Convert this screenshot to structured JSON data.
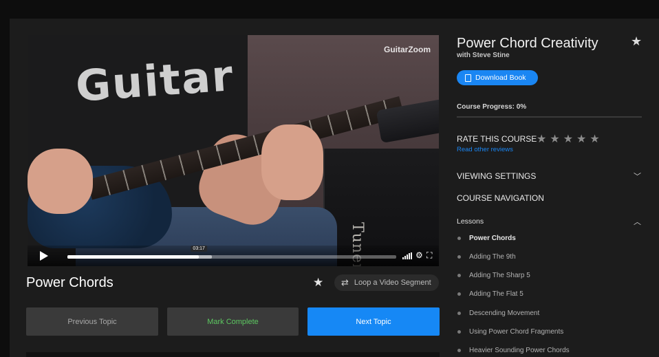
{
  "video": {
    "watermark": "GuitarZoom",
    "amp_brand": "Tuner",
    "shirt_text": "Guitar",
    "time_tooltip": "03:17",
    "progress_fraction": 0.4,
    "buffer_fraction": 0.44
  },
  "topic": {
    "title": "Power Chords",
    "loop_label": "Loop a Video Segment"
  },
  "nav": {
    "previous": "Previous Topic",
    "mark_complete": "Mark Complete",
    "next": "Next Topic"
  },
  "course": {
    "title": "Power Chord Creativity",
    "instructor": "with Steve Stine",
    "download_label": "Download Book",
    "progress_label": "Course Progress: 0%",
    "rate_label": "RATE THIS COURSE",
    "reviews_link": "Read other reviews",
    "viewing_settings": "VIEWING SETTINGS",
    "course_navigation": "COURSE NAVIGATION",
    "lessons_label": "Lessons",
    "lessons": [
      "Power Chords",
      "Adding The 9th",
      "Adding The Sharp 5",
      "Adding The Flat 5",
      "Descending Movement",
      "Using Power Chord Fragments",
      "Heavier Sounding Power Chords"
    ]
  },
  "colors": {
    "accent": "#1a86f3",
    "complete": "#5dc861",
    "background": "#1c1c1c"
  }
}
